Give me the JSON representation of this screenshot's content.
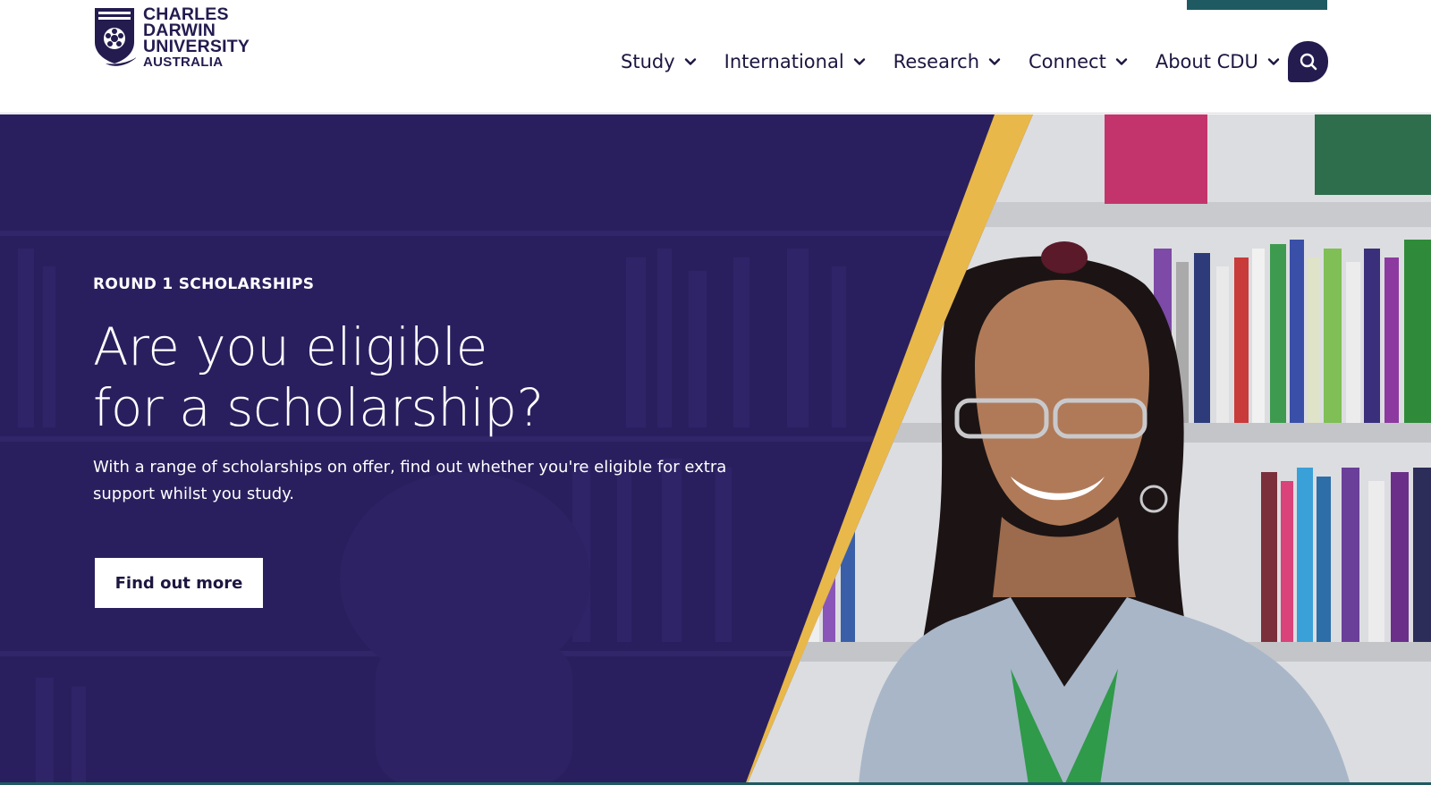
{
  "site": {
    "logo": {
      "lines": [
        "CHARLES",
        "DARWIN",
        "UNIVERSITY",
        "AUSTRALIA"
      ],
      "icon": "university-shield-crest"
    }
  },
  "nav": {
    "items": [
      {
        "label": "Study",
        "icon": "chevron-down-icon"
      },
      {
        "label": "International",
        "icon": "chevron-down-icon"
      },
      {
        "label": "Research",
        "icon": "chevron-down-icon"
      },
      {
        "label": "Connect",
        "icon": "chevron-down-icon"
      },
      {
        "label": "About CDU",
        "icon": "chevron-down-icon"
      }
    ],
    "search_icon": "search-icon"
  },
  "hero": {
    "eyebrow": "ROUND 1 SCHOLARSHIPS",
    "headline_line1": "Are you eligible",
    "headline_line2": "for a scholarship?",
    "lede": "With a range of scholarships on offer, find out whether you're eligible for extra support whilst you study.",
    "cta_label": "Find out more"
  },
  "colors": {
    "brand_navy": "#241b4f",
    "hero_overlay": "#2a1f5e",
    "accent_gold": "#e8b84a",
    "accent_teal": "#1f5a62",
    "text_dark": "#1d1640"
  }
}
